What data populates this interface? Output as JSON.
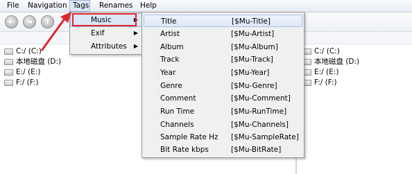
{
  "menubar": {
    "items": [
      "File",
      "Navigation",
      "Tags",
      "Renames",
      "Help"
    ]
  },
  "toolbar": {
    "buttons": [
      "back-icon",
      "forward-icon",
      "up-icon"
    ]
  },
  "left_panel": {
    "drives": [
      "C:/ (C:)",
      "本地磁盘 (D:)",
      "E:/ (E:)",
      "F:/ (F:)"
    ]
  },
  "right_panel": {
    "drives": [
      "C:/ (C:)",
      "本地磁盘 (D:)",
      "E:/ (E:)",
      "F:/ (F:)"
    ]
  },
  "tags_menu": {
    "items": [
      {
        "label": "Music",
        "has_submenu": true
      },
      {
        "label": "Exif",
        "has_submenu": true
      },
      {
        "label": "Attributes",
        "has_submenu": true
      }
    ]
  },
  "music_submenu": {
    "items": [
      {
        "label": "Title",
        "value": "[$Mu-Title]"
      },
      {
        "label": "Artist",
        "value": "[$Mu-Artist]"
      },
      {
        "label": "Album",
        "value": "[$Mu-Album]"
      },
      {
        "label": "Track",
        "value": "[$Mu-Track]"
      },
      {
        "label": "Year",
        "value": "[$Mu-Year]"
      },
      {
        "label": "Genre",
        "value": "[$Mu-Genre]"
      },
      {
        "label": "Comment",
        "value": "[$Mu-Comment]"
      },
      {
        "label": "Run Time",
        "value": "[$Mu-RunTime]"
      },
      {
        "label": "Channels",
        "value": "[$Mu-Channels]"
      },
      {
        "label": "Sample Rate Hz",
        "value": "[$Mu-SampleRate]"
      },
      {
        "label": "Bit Rate kbps",
        "value": "[$Mu-BitRate]"
      }
    ]
  },
  "colors": {
    "highlight_border": "#e3242b",
    "menu_hover": "#dbe7f7"
  }
}
